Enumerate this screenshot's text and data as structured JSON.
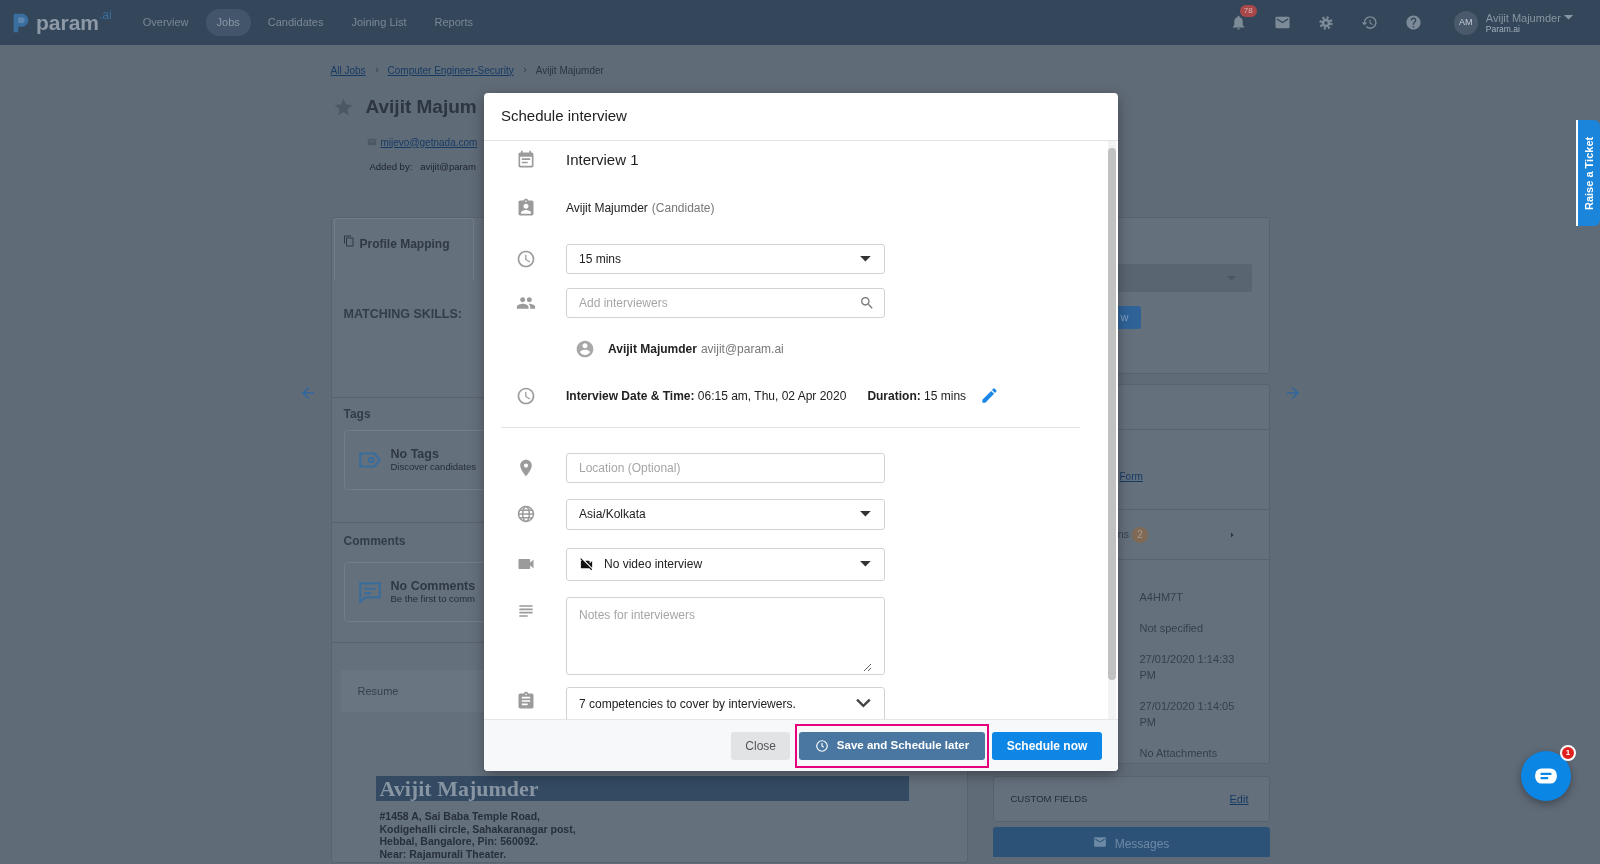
{
  "navbar": {
    "logo": {
      "name": "param",
      "suffix": ".ai"
    },
    "nav_items": [
      {
        "label": "Overview",
        "selected": false
      },
      {
        "label": "Jobs",
        "selected": true
      },
      {
        "label": "Candidates",
        "selected": false
      },
      {
        "label": "Joining List",
        "selected": false
      },
      {
        "label": "Reports",
        "selected": false
      }
    ],
    "notification_count": "78",
    "user": {
      "initials": "AM",
      "name": "Avijit Majumder",
      "org": "Param.ai"
    }
  },
  "breadcrumb": [
    {
      "label": "All Jobs",
      "kind": "link"
    },
    {
      "label": "Computer Engineer-Security",
      "kind": "link"
    },
    {
      "label": "Avijit Majumder",
      "kind": "current"
    }
  ],
  "candidate": {
    "name": "Avijit Majum",
    "email": "mijevo@getnada.com",
    "added_by_label": "Added by:",
    "added_by": "avijit@param"
  },
  "profile_tabs": [
    {
      "label": "Profile Mapping",
      "selected": true
    }
  ],
  "matching_skills": {
    "title": "MATCHING SKILLS:"
  },
  "tags": {
    "title": "Tags",
    "empty_title": "No Tags",
    "empty_hint": "Discover candidates"
  },
  "comments": {
    "title": "Comments",
    "empty_title": "No Comments",
    "empty_hint": "Be the first to comm"
  },
  "resume": {
    "label": "Resume",
    "name": "Avijit Majumder",
    "address": [
      "#1458 A, Sai Baba Temple Road,",
      "Kodigehalli circle, Sahakaranagar post,",
      "Hebbal, Bangalore, Pin: 560092.",
      "Near: Rajamurali Theater."
    ]
  },
  "side_panel": {
    "button_fragment": "w",
    "link_fragment": "Form",
    "section_fragment": "ns",
    "section_count": "2",
    "details": [
      "A4HM7T",
      "Not specified",
      "27/01/2020 1:14:33 PM",
      "27/01/2020 1:14:05 PM",
      "No Attachments"
    ],
    "custom_fields": {
      "title": "CUSTOM FIELDS",
      "action": "Edit"
    },
    "messages": "Messages"
  },
  "raise_ticket": "Raise a Ticket",
  "chat": {
    "unread": "1"
  },
  "modal": {
    "title": "Schedule interview",
    "interview_name": "Interview 1",
    "candidate": {
      "name": "Avijit Majumder",
      "role": "(Candidate)"
    },
    "duration": {
      "value": "15 mins"
    },
    "interviewer_search": {
      "placeholder": "Add interviewers"
    },
    "interviewers": [
      {
        "name": "Avijit Majumder",
        "email": "avijit@param.ai"
      }
    ],
    "schedule": {
      "date": "**Interview Date & Time:** 06:15 am, Thu, 02 Apr 2020",
      "duration": "**Duration:** 15 mins"
    },
    "location": {
      "placeholder": "Location (Optional)"
    },
    "timezone": {
      "value": "Asia/Kolkata"
    },
    "video": {
      "value": "No video interview"
    },
    "notes": {
      "placeholder": "Notes for interviewers"
    },
    "competencies": {
      "value": "7 competencies to cover by interviewers."
    },
    "buttons": [
      {
        "label": "Close",
        "kind": "secondary",
        "highlighted": false
      },
      {
        "label": "Save and Schedule later",
        "kind": "later",
        "highlighted": true
      },
      {
        "label": "Schedule now",
        "kind": "primary",
        "highlighted": false
      }
    ]
  }
}
